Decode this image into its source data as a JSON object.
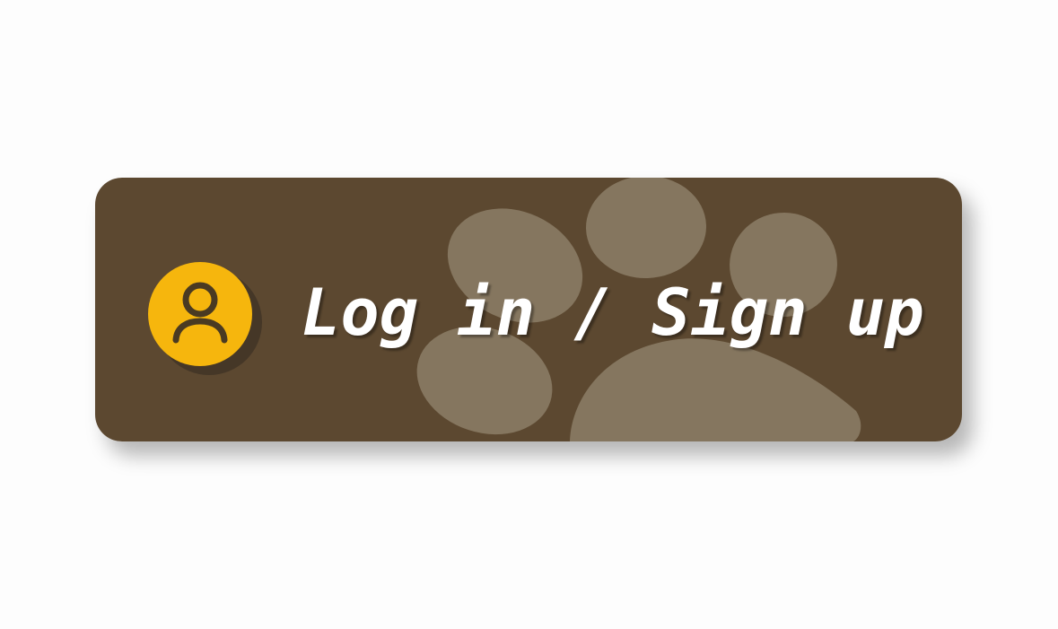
{
  "login_button": {
    "label": "Log in / Sign up",
    "background_color": "#5c4830",
    "paw_color": "#85765f",
    "avatar_color": "#f6b60d",
    "avatar_icon": "user-icon",
    "background_icon": "paw-print-icon"
  }
}
